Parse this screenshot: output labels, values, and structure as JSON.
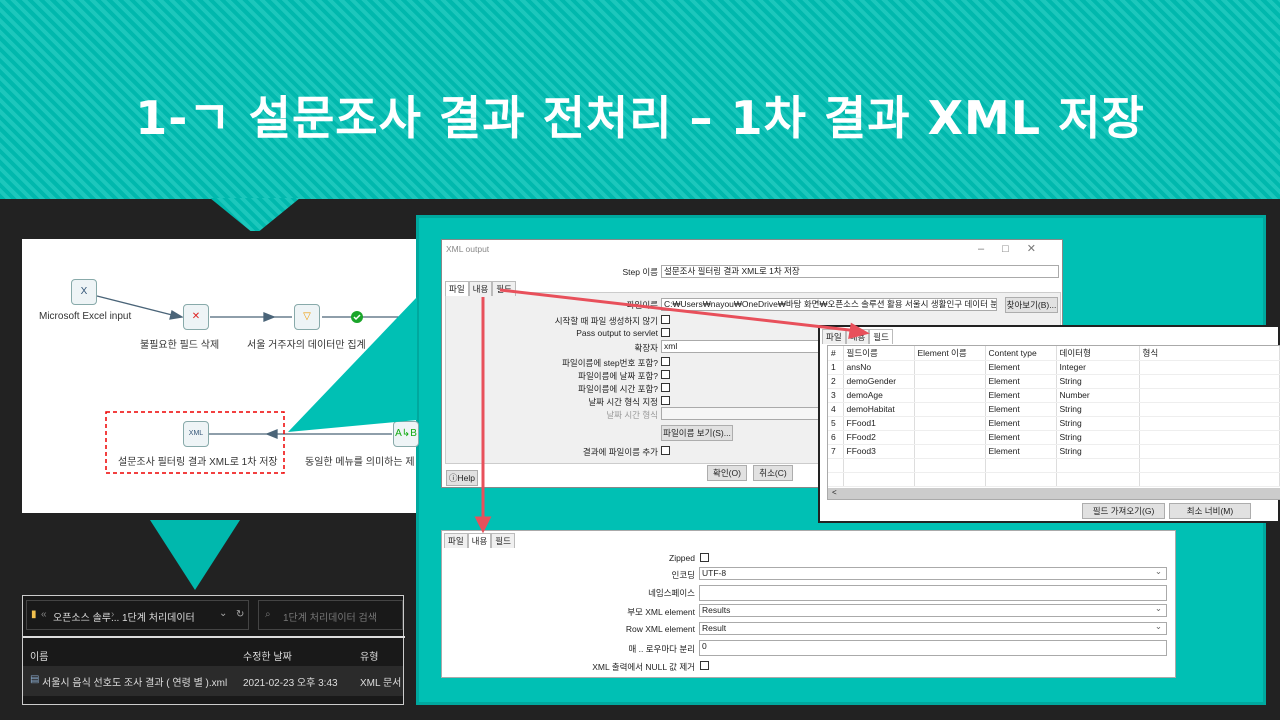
{
  "slide_title": "1-ㄱ 설문조사 결과 전처리 – 1차 결과 XML 저장",
  "workflow": {
    "nodes": [
      "Microsoft Excel input",
      "불필요한 필드 삭제",
      "서울 거주자의 데이터만 집계",
      "설문조사 필터링 결과 XML로 1차 저장",
      "동일한 메뉴를 의미하는 제"
    ]
  },
  "dialog": {
    "title": "XML output",
    "step_label": "Step 이름",
    "step_value": "설문조사 필터링 결과 XML로 1차 저장",
    "tabs": [
      "파일",
      "내용",
      "필드"
    ],
    "filename_label": "파일이름",
    "filename_value": "C:₩Users₩nayou₩OneDrive₩바탕 화면₩오픈소스 솔루션 활용 서울시 생활인구 데이터 분석",
    "browse": "찾아보기(B)...",
    "opts": [
      "시작할 때 파일 생성하지 않기",
      "Pass output to servlet"
    ],
    "ext_label": "확장자",
    "ext_value": "xml",
    "opts2": [
      "파일이름에 step번호 포함?",
      "파일이름에 날짜 포함?",
      "파일이름에 시간 포함?",
      "날짜 시간 형식 지정"
    ],
    "datefmt_label": "날짜 시간 형식",
    "show_filename": "파일이름 보기(S)...",
    "add_result": "결과에 파일이름 추가",
    "help": "Help",
    "ok": "확인(O)",
    "cancel": "취소(C)"
  },
  "fields_panel": {
    "tabs": [
      "파일",
      "내용",
      "필드"
    ],
    "headers": [
      "#",
      "필드이름",
      "Element 이름",
      "Content type",
      "데이터형",
      "형식"
    ],
    "rows": [
      [
        "1",
        "ansNo",
        "",
        "Element",
        "Integer",
        ""
      ],
      [
        "2",
        "demoGender",
        "",
        "Element",
        "String",
        ""
      ],
      [
        "3",
        "demoAge",
        "",
        "Element",
        "Number",
        ""
      ],
      [
        "4",
        "demoHabitat",
        "",
        "Element",
        "String",
        ""
      ],
      [
        "5",
        "FFood1",
        "",
        "Element",
        "String",
        ""
      ],
      [
        "6",
        "FFood2",
        "",
        "Element",
        "String",
        ""
      ],
      [
        "7",
        "FFood3",
        "",
        "Element",
        "String",
        ""
      ]
    ],
    "get_fields": "필드 가져오기(G)",
    "min_width": "최소 너비(M)"
  },
  "content_panel": {
    "tabs": [
      "파일",
      "내용",
      "필드"
    ],
    "zipped": "Zipped",
    "encoding_label": "인코딩",
    "encoding_value": "UTF-8",
    "namespace_label": "네임스페이스",
    "parent_label": "부모 XML element",
    "parent_value": "Results",
    "row_label": "Row XML element",
    "row_value": "Result",
    "split_label": "매 .. 로우마다 분리",
    "split_value": "0",
    "null_label": "XML 출력에서 NULL 값 제거"
  },
  "explorer": {
    "path": [
      "오픈소스 솔루...",
      "1단계 처리데이터"
    ],
    "search_placeholder": "1단계 처리데이터 검색",
    "headers": [
      "이름",
      "수정한 날짜",
      "유형"
    ],
    "file": {
      "name": "서울시 음식 선호도 조사 결과 ( 연령 별 ).xml",
      "date": "2021-02-23 오후 3:43",
      "type": "XML 문서"
    }
  },
  "colors": {
    "teal": "#00c0b4",
    "arrow": "#e8505b",
    "dark": "#222222"
  }
}
